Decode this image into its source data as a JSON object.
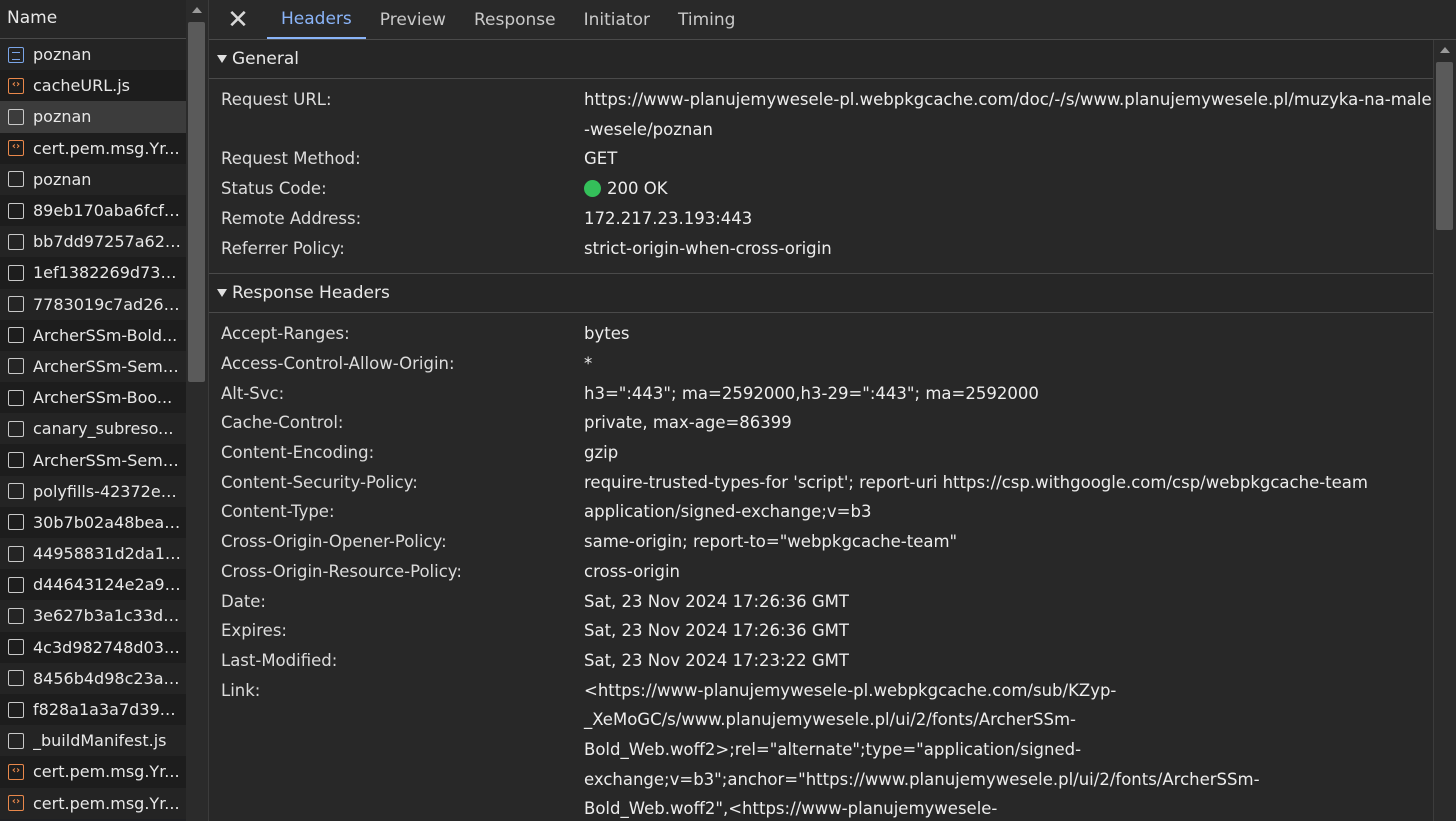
{
  "left": {
    "header": "Name",
    "rows": [
      {
        "name": "poznan",
        "icon": "document-icon"
      },
      {
        "name": "cacheURL.js",
        "icon": "script-icon"
      },
      {
        "name": "poznan",
        "icon": "file-icon"
      },
      {
        "name": "cert.pem.msg.Yr...",
        "icon": "script-icon"
      },
      {
        "name": "poznan",
        "icon": "file-icon"
      },
      {
        "name": "89eb170aba6fcf1...",
        "icon": "file-icon"
      },
      {
        "name": "bb7dd97257a62d...",
        "icon": "file-icon"
      },
      {
        "name": "1ef1382269d73bc...",
        "icon": "file-icon"
      },
      {
        "name": "7783019c7ad2658...",
        "icon": "file-icon"
      },
      {
        "name": "ArcherSSm-Bold...",
        "icon": "file-icon"
      },
      {
        "name": "ArcherSSm-Semi...",
        "icon": "file-icon"
      },
      {
        "name": "ArcherSSm-Boo...",
        "icon": "file-icon"
      },
      {
        "name": "canary_subreso...",
        "icon": "file-icon"
      },
      {
        "name": "ArcherSSm-Semi...",
        "icon": "file-icon"
      },
      {
        "name": "polyfills-42372ed...",
        "icon": "file-icon"
      },
      {
        "name": "30b7b02a48beaa...",
        "icon": "file-icon"
      },
      {
        "name": "44958831d2da1b...",
        "icon": "file-icon"
      },
      {
        "name": "d44643124e2a96...",
        "icon": "file-icon"
      },
      {
        "name": "3e627b3a1c33dcc...",
        "icon": "file-icon"
      },
      {
        "name": "4c3d982748d039...",
        "icon": "file-icon"
      },
      {
        "name": "8456b4d98c23a1...",
        "icon": "file-icon"
      },
      {
        "name": "f828a1a3a7d398c...",
        "icon": "file-icon"
      },
      {
        "name": "_buildManifest.js",
        "icon": "file-icon"
      },
      {
        "name": "cert.pem.msg.Yr...",
        "icon": "script-icon"
      },
      {
        "name": "cert.pem.msg.Yr...",
        "icon": "script-icon"
      }
    ]
  },
  "tabs": {
    "close_icon": "close-icon",
    "items": [
      "Headers",
      "Preview",
      "Response",
      "Initiator",
      "Timing"
    ],
    "active": "Headers"
  },
  "general": {
    "title": "General",
    "rows": [
      {
        "key": "Request URL:",
        "value": "https://www-planujemywesele-pl.webpkgcache.com/doc/-/s/www.planujemywesele.pl/muzyka-na-male-wesele/poznan"
      },
      {
        "key": "Request Method:",
        "value": "GET"
      },
      {
        "key": "Status Code:",
        "value": "200 OK"
      },
      {
        "key": "Remote Address:",
        "value": "172.217.23.193:443"
      },
      {
        "key": "Referrer Policy:",
        "value": "strict-origin-when-cross-origin"
      }
    ]
  },
  "response_headers": {
    "title": "Response Headers",
    "rows": [
      {
        "key": "Accept-Ranges:",
        "value": "bytes"
      },
      {
        "key": "Access-Control-Allow-Origin:",
        "value": "*"
      },
      {
        "key": "Alt-Svc:",
        "value": "h3=\":443\"; ma=2592000,h3-29=\":443\"; ma=2592000"
      },
      {
        "key": "Cache-Control:",
        "value": "private, max-age=86399"
      },
      {
        "key": "Content-Encoding:",
        "value": "gzip"
      },
      {
        "key": "Content-Security-Policy:",
        "value": "require-trusted-types-for 'script'; report-uri https://csp.withgoogle.com/csp/webpkgcache-team"
      },
      {
        "key": "Content-Type:",
        "value": "application/signed-exchange;v=b3"
      },
      {
        "key": "Cross-Origin-Opener-Policy:",
        "value": "same-origin; report-to=\"webpkgcache-team\""
      },
      {
        "key": "Cross-Origin-Resource-Policy:",
        "value": "cross-origin"
      },
      {
        "key": "Date:",
        "value": "Sat, 23 Nov 2024 17:26:36 GMT"
      },
      {
        "key": "Expires:",
        "value": "Sat, 23 Nov 2024 17:26:36 GMT"
      },
      {
        "key": "Last-Modified:",
        "value": "Sat, 23 Nov 2024 17:23:22 GMT"
      },
      {
        "key": "Link:",
        "value": "<https://www-planujemywesele-pl.webpkgcache.com/sub/KZyp-_XeMoGC/s/www.planujemywesele.pl/ui/2/fonts/ArcherSSm-Bold_Web.woff2>;rel=\"alternate\";type=\"application/signed-exchange;v=b3\";anchor=\"https://www.planujemywesele.pl/ui/2/fonts/ArcherSSm-Bold_Web.woff2\",<https://www-planujemywesele-"
      }
    ]
  },
  "colors": {
    "accent": "#8ab4f8",
    "status_ok": "#34c05a",
    "script_icon": "#e9884b",
    "document_icon": "#7aa5e8"
  }
}
